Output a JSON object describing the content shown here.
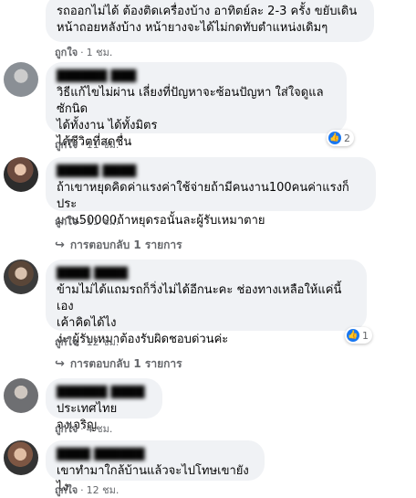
{
  "comments": [
    {
      "text": "รถออกไม่ได้ ต้องติดเครื่องบ้าง อาทิตย์ละ 2-3 ครั้ง ขยับเดิน\nหน้าถอยหลังบ้าง หน้ายางจะได้ไม่กดทับตำแหน่งเดิมๆ",
      "like": "ถูกใจ",
      "time": "1 ชม."
    },
    {
      "text": "วิธีแก้ไขไม่ผ่าน เลี่ยงที่ปัญหาจะซ้อนปัญหา ใส่ใจดูแลซักนิด\nได้ทั้งงาน ได้ทั้งมิตร\nได้ชีวิตที่สดชื่น",
      "like": "ถูกใจ",
      "time": "11 ชม.",
      "reactions": "2"
    },
    {
      "text": "ถ้าเขาหยุดคิดค่าแรงค่าใช้จ่ายถ้ามีคนงาน100คนค่าแรงก็ประ\nมาน50000ถ้าหยุดรอนั้นละผู้รับเหมาตาย",
      "like": "ถูกใจ",
      "time": "11 ชม.",
      "replies": "การตอบกลับ 1 รายการ"
    },
    {
      "text": "ข้ามไม่ได้แถมรถก็วิ่งไม่ได้อีกนะคะ ช่องทางเหลือให้แค่นี้เอง\nเค้าคิดได้ไง\nง่ะ ผู้รับเหมาต้องรับผิดชอบด่วนค่ะ",
      "like": "ถูกใจ",
      "time": "12 ชม.",
      "reactions": "1",
      "replies": "การตอบกลับ 1 รายการ"
    },
    {
      "text": "ประเทศไทยจงเจริญ",
      "like": "ถูกใจ",
      "time": "4 ชม."
    },
    {
      "text": "เขาทำมาใกล้บ้านแล้วจะไปโทษเขายังไง",
      "like": "ถูกใจ",
      "time": "12 ชม."
    }
  ]
}
